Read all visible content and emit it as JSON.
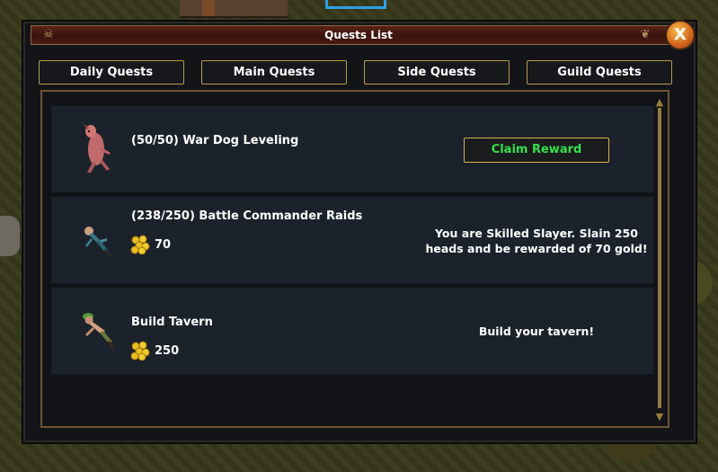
{
  "window": {
    "title": "Quests List",
    "close_label": "X"
  },
  "tabs": [
    {
      "label": "Daily Quests"
    },
    {
      "label": "Main Quests"
    },
    {
      "label": "Side Quests"
    },
    {
      "label": "Guild Quests"
    }
  ],
  "quests": [
    {
      "name": "(50/50) War Dog Leveling",
      "portrait": "war-dog",
      "action_label": "Claim Reward"
    },
    {
      "name": "(238/250) Battle Commander Raids",
      "portrait": "commander",
      "reward": "70",
      "reward_icon": "gold-coins-icon",
      "description_line1": "You are Skilled Slayer. Slain 250",
      "description_line2": "heads and be rewarded of 70 gold!"
    },
    {
      "name": "Build Tavern",
      "portrait": "builder",
      "reward": "250",
      "reward_icon": "gold-coins-icon",
      "description_line1": "Build your tavern!"
    }
  ],
  "colors": {
    "claim_text": "#34e04a",
    "tab_border": "#b99a52",
    "title_bar": "#5a2418"
  }
}
